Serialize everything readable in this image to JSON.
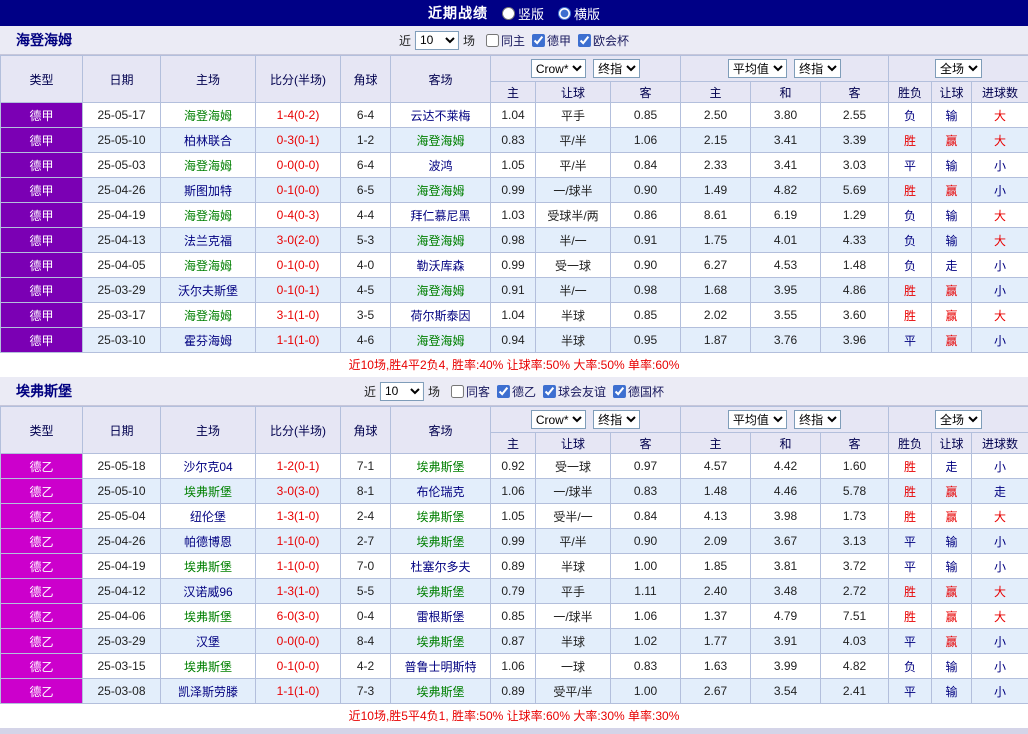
{
  "topbar": {
    "title": "近期战绩",
    "layout_options": [
      {
        "label": "竖版",
        "selected": false
      },
      {
        "label": "横版",
        "selected": true
      }
    ]
  },
  "colors": {
    "topbar_bg": "#000086",
    "accent_red": "#E80000",
    "focus_team_green": "#008000",
    "default_navy": "#000080"
  },
  "sections": [
    {
      "team": "海登海姆",
      "league_color": "#7B00B4",
      "filter": {
        "prefix": "近",
        "count": "10",
        "suffix": "场",
        "checkboxes": [
          {
            "label": "同主",
            "checked": false
          },
          {
            "label": "德甲",
            "checked": true
          },
          {
            "label": "欧会杯",
            "checked": true
          }
        ]
      },
      "header": {
        "main_cols": [
          "类型",
          "日期",
          "主场",
          "比分(半场)",
          "角球",
          "客场"
        ],
        "asia_selects": [
          "Crow*",
          "终指"
        ],
        "europe_selects": [
          "平均值",
          "终指"
        ],
        "result_selects": [
          "全场"
        ],
        "sub_cols": [
          "主",
          "让球",
          "客",
          "主",
          "和",
          "客",
          "胜负",
          "让球",
          "进球数"
        ]
      },
      "rows": [
        {
          "league": "德甲",
          "date": "25-05-17",
          "home": "海登海姆",
          "score": "1-4(0-2)",
          "corner": "6-4",
          "away": "云达不莱梅",
          "focus": "home",
          "asia_home": "1.04",
          "handicap": "平手",
          "asia_away": "0.85",
          "avg_home": "2.50",
          "avg_draw": "3.80",
          "avg_away": "2.55",
          "result": "负",
          "cover": "输",
          "goals": "大"
        },
        {
          "league": "德甲",
          "date": "25-05-10",
          "home": "柏林联合",
          "score": "0-3(0-1)",
          "corner": "1-2",
          "away": "海登海姆",
          "focus": "away",
          "asia_home": "0.83",
          "handicap": "平/半",
          "asia_away": "1.06",
          "avg_home": "2.15",
          "avg_draw": "3.41",
          "avg_away": "3.39",
          "result": "胜",
          "cover": "赢",
          "goals": "大"
        },
        {
          "league": "德甲",
          "date": "25-05-03",
          "home": "海登海姆",
          "score": "0-0(0-0)",
          "corner": "6-4",
          "away": "波鸿",
          "focus": "home",
          "asia_home": "1.05",
          "handicap": "平/半",
          "asia_away": "0.84",
          "avg_home": "2.33",
          "avg_draw": "3.41",
          "avg_away": "3.03",
          "result": "平",
          "cover": "输",
          "goals": "小"
        },
        {
          "league": "德甲",
          "date": "25-04-26",
          "home": "斯图加特",
          "score": "0-1(0-0)",
          "corner": "6-5",
          "away": "海登海姆",
          "focus": "away",
          "asia_home": "0.99",
          "handicap": "一/球半",
          "asia_away": "0.90",
          "avg_home": "1.49",
          "avg_draw": "4.82",
          "avg_away": "5.69",
          "result": "胜",
          "cover": "赢",
          "goals": "小"
        },
        {
          "league": "德甲",
          "date": "25-04-19",
          "home": "海登海姆",
          "score": "0-4(0-3)",
          "corner": "4-4",
          "away": "拜仁慕尼黑",
          "focus": "home",
          "asia_home": "1.03",
          "handicap": "受球半/两",
          "asia_away": "0.86",
          "avg_home": "8.61",
          "avg_draw": "6.19",
          "avg_away": "1.29",
          "result": "负",
          "cover": "输",
          "goals": "大"
        },
        {
          "league": "德甲",
          "date": "25-04-13",
          "home": "法兰克福",
          "score": "3-0(2-0)",
          "corner": "5-3",
          "away": "海登海姆",
          "focus": "away",
          "asia_home": "0.98",
          "handicap": "半/一",
          "asia_away": "0.91",
          "avg_home": "1.75",
          "avg_draw": "4.01",
          "avg_away": "4.33",
          "result": "负",
          "cover": "输",
          "goals": "大"
        },
        {
          "league": "德甲",
          "date": "25-04-05",
          "home": "海登海姆",
          "score": "0-1(0-0)",
          "corner": "4-0",
          "away": "勒沃库森",
          "focus": "home",
          "asia_home": "0.99",
          "handicap": "受一球",
          "asia_away": "0.90",
          "avg_home": "6.27",
          "avg_draw": "4.53",
          "avg_away": "1.48",
          "result": "负",
          "cover": "走",
          "goals": "小"
        },
        {
          "league": "德甲",
          "date": "25-03-29",
          "home": "沃尔夫斯堡",
          "score": "0-1(0-1)",
          "corner": "4-5",
          "away": "海登海姆",
          "focus": "away",
          "asia_home": "0.91",
          "handicap": "半/一",
          "asia_away": "0.98",
          "avg_home": "1.68",
          "avg_draw": "3.95",
          "avg_away": "4.86",
          "result": "胜",
          "cover": "赢",
          "goals": "小"
        },
        {
          "league": "德甲",
          "date": "25-03-17",
          "home": "海登海姆",
          "score": "3-1(1-0)",
          "corner": "3-5",
          "away": "荷尔斯泰因",
          "focus": "home",
          "asia_home": "1.04",
          "handicap": "半球",
          "asia_away": "0.85",
          "avg_home": "2.02",
          "avg_draw": "3.55",
          "avg_away": "3.60",
          "result": "胜",
          "cover": "赢",
          "goals": "大"
        },
        {
          "league": "德甲",
          "date": "25-03-10",
          "home": "霍芬海姆",
          "score": "1-1(1-0)",
          "corner": "4-6",
          "away": "海登海姆",
          "focus": "away",
          "asia_home": "0.94",
          "handicap": "半球",
          "asia_away": "0.95",
          "avg_home": "1.87",
          "avg_draw": "3.76",
          "avg_away": "3.96",
          "result": "平",
          "cover": "赢",
          "goals": "小"
        }
      ],
      "summary": "近10场,胜4平2负4, 胜率:40% 让球率:50% 大率:50% 单率:60%"
    },
    {
      "team": "埃弗斯堡",
      "league_color": "#CC00CC",
      "filter": {
        "prefix": "近",
        "count": "10",
        "suffix": "场",
        "checkboxes": [
          {
            "label": "同客",
            "checked": false
          },
          {
            "label": "德乙",
            "checked": true
          },
          {
            "label": "球会友谊",
            "checked": true
          },
          {
            "label": "德国杯",
            "checked": true
          }
        ]
      },
      "header": {
        "main_cols": [
          "类型",
          "日期",
          "主场",
          "比分(半场)",
          "角球",
          "客场"
        ],
        "asia_selects": [
          "Crow*",
          "终指"
        ],
        "europe_selects": [
          "平均值",
          "终指"
        ],
        "result_selects": [
          "全场"
        ],
        "sub_cols": [
          "主",
          "让球",
          "客",
          "主",
          "和",
          "客",
          "胜负",
          "让球",
          "进球数"
        ]
      },
      "rows": [
        {
          "league": "德乙",
          "date": "25-05-18",
          "home": "沙尔克04",
          "score": "1-2(0-1)",
          "corner": "7-1",
          "away": "埃弗斯堡",
          "focus": "away",
          "asia_home": "0.92",
          "handicap": "受一球",
          "asia_away": "0.97",
          "avg_home": "4.57",
          "avg_draw": "4.42",
          "avg_away": "1.60",
          "result": "胜",
          "cover": "走",
          "goals": "小"
        },
        {
          "league": "德乙",
          "date": "25-05-10",
          "home": "埃弗斯堡",
          "score": "3-0(3-0)",
          "corner": "8-1",
          "away": "布伦瑞克",
          "focus": "home",
          "asia_home": "1.06",
          "handicap": "一/球半",
          "asia_away": "0.83",
          "avg_home": "1.48",
          "avg_draw": "4.46",
          "avg_away": "5.78",
          "result": "胜",
          "cover": "赢",
          "goals": "走"
        },
        {
          "league": "德乙",
          "date": "25-05-04",
          "home": "纽伦堡",
          "score": "1-3(1-0)",
          "corner": "2-4",
          "away": "埃弗斯堡",
          "focus": "away",
          "asia_home": "1.05",
          "handicap": "受半/一",
          "asia_away": "0.84",
          "avg_home": "4.13",
          "avg_draw": "3.98",
          "avg_away": "1.73",
          "result": "胜",
          "cover": "赢",
          "goals": "大"
        },
        {
          "league": "德乙",
          "date": "25-04-26",
          "home": "帕德博恩",
          "score": "1-1(0-0)",
          "corner": "2-7",
          "away": "埃弗斯堡",
          "focus": "away",
          "asia_home": "0.99",
          "handicap": "平/半",
          "asia_away": "0.90",
          "avg_home": "2.09",
          "avg_draw": "3.67",
          "avg_away": "3.13",
          "result": "平",
          "cover": "输",
          "goals": "小"
        },
        {
          "league": "德乙",
          "date": "25-04-19",
          "home": "埃弗斯堡",
          "score": "1-1(0-0)",
          "corner": "7-0",
          "away": "杜塞尔多夫",
          "focus": "home",
          "asia_home": "0.89",
          "handicap": "半球",
          "asia_away": "1.00",
          "avg_home": "1.85",
          "avg_draw": "3.81",
          "avg_away": "3.72",
          "result": "平",
          "cover": "输",
          "goals": "小"
        },
        {
          "league": "德乙",
          "date": "25-04-12",
          "home": "汉诺威96",
          "score": "1-3(1-0)",
          "corner": "5-5",
          "away": "埃弗斯堡",
          "focus": "away",
          "asia_home": "0.79",
          "handicap": "平手",
          "asia_away": "1.11",
          "avg_home": "2.40",
          "avg_draw": "3.48",
          "avg_away": "2.72",
          "result": "胜",
          "cover": "赢",
          "goals": "大"
        },
        {
          "league": "德乙",
          "date": "25-04-06",
          "home": "埃弗斯堡",
          "score": "6-0(3-0)",
          "corner": "0-4",
          "away": "雷根斯堡",
          "focus": "home",
          "asia_home": "0.85",
          "handicap": "一/球半",
          "asia_away": "1.06",
          "avg_home": "1.37",
          "avg_draw": "4.79",
          "avg_away": "7.51",
          "result": "胜",
          "cover": "赢",
          "goals": "大"
        },
        {
          "league": "德乙",
          "date": "25-03-29",
          "home": "汉堡",
          "score": "0-0(0-0)",
          "corner": "8-4",
          "away": "埃弗斯堡",
          "focus": "away",
          "asia_home": "0.87",
          "handicap": "半球",
          "asia_away": "1.02",
          "avg_home": "1.77",
          "avg_draw": "3.91",
          "avg_away": "4.03",
          "result": "平",
          "cover": "赢",
          "goals": "小"
        },
        {
          "league": "德乙",
          "date": "25-03-15",
          "home": "埃弗斯堡",
          "score": "0-1(0-0)",
          "corner": "4-2",
          "away": "普鲁士明斯特",
          "focus": "home",
          "asia_home": "1.06",
          "handicap": "一球",
          "asia_away": "0.83",
          "avg_home": "1.63",
          "avg_draw": "3.99",
          "avg_away": "4.82",
          "result": "负",
          "cover": "输",
          "goals": "小"
        },
        {
          "league": "德乙",
          "date": "25-03-08",
          "home": "凯泽斯劳滕",
          "score": "1-1(1-0)",
          "corner": "7-3",
          "away": "埃弗斯堡",
          "focus": "away",
          "asia_home": "0.89",
          "handicap": "受平/半",
          "asia_away": "1.00",
          "avg_home": "2.67",
          "avg_draw": "3.54",
          "avg_away": "2.41",
          "result": "平",
          "cover": "输",
          "goals": "小"
        }
      ],
      "summary": "近10场,胜5平4负1, 胜率:50% 让球率:60% 大率:30% 单率:30%"
    }
  ]
}
